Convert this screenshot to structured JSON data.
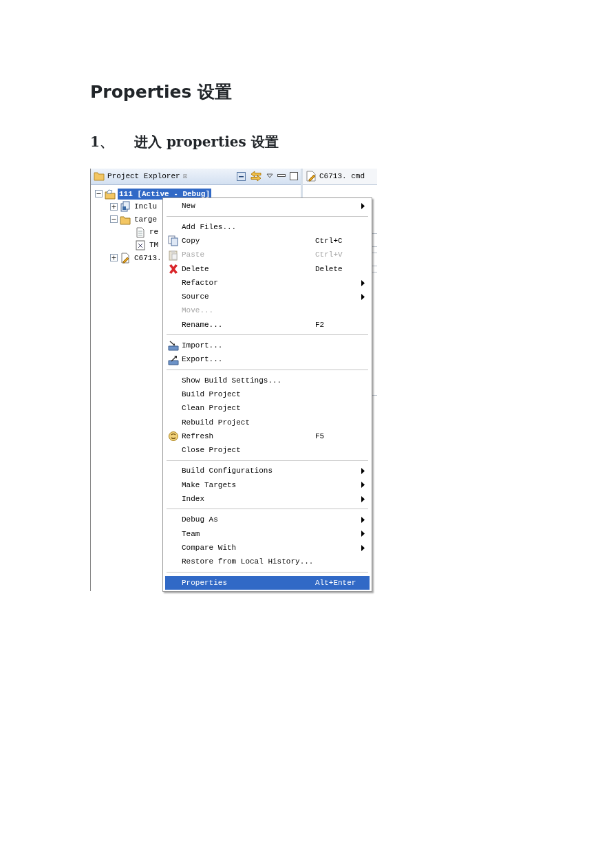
{
  "heading": "Properties 设置",
  "step": {
    "number": "1、",
    "text": "进入 properties 设置"
  },
  "explorer": {
    "title": "Project Explorer",
    "close": "☒",
    "tree": [
      {
        "label": "111  [Active - Debug]",
        "selected": true,
        "expanded": true,
        "children": [
          {
            "label": "Inclu",
            "selected": false,
            "expanded": false
          },
          {
            "label": "targe",
            "selected": false,
            "expanded": true,
            "children": [
              {
                "label": "re",
                "selected": false
              },
              {
                "label": "TM",
                "selected": false
              }
            ]
          },
          {
            "label": "C6713.",
            "selected": false,
            "expanded": false
          }
        ]
      }
    ]
  },
  "editor_tab": {
    "label": "C6713. cmd"
  },
  "menu": [
    {
      "kind": "item",
      "label": "New",
      "submenu": true,
      "disabled": false,
      "selected": false
    },
    {
      "kind": "separator"
    },
    {
      "kind": "item",
      "label": "Add Files...",
      "submenu": false,
      "disabled": false,
      "selected": false
    },
    {
      "kind": "item",
      "label": "Copy",
      "shortcut": "Ctrl+C",
      "submenu": false,
      "disabled": false,
      "selected": false
    },
    {
      "kind": "item",
      "label": "Paste",
      "shortcut": "Ctrl+V",
      "submenu": false,
      "disabled": true,
      "selected": false
    },
    {
      "kind": "item",
      "label": "Delete",
      "shortcut": "Delete",
      "submenu": false,
      "disabled": false,
      "selected": false
    },
    {
      "kind": "item",
      "label": "Refactor",
      "submenu": true,
      "disabled": false,
      "selected": false
    },
    {
      "kind": "item",
      "label": "Source",
      "submenu": true,
      "disabled": false,
      "selected": false
    },
    {
      "kind": "item",
      "label": "Move...",
      "submenu": false,
      "disabled": true,
      "selected": false
    },
    {
      "kind": "item",
      "label": "Rename...",
      "shortcut": "F2",
      "submenu": false,
      "disabled": false,
      "selected": false
    },
    {
      "kind": "separator"
    },
    {
      "kind": "item",
      "label": "Import...",
      "submenu": false,
      "disabled": false,
      "selected": false
    },
    {
      "kind": "item",
      "label": "Export...",
      "submenu": false,
      "disabled": false,
      "selected": false
    },
    {
      "kind": "separator"
    },
    {
      "kind": "item",
      "label": "Show Build Settings...",
      "submenu": false,
      "disabled": false,
      "selected": false
    },
    {
      "kind": "item",
      "label": "Build Project",
      "submenu": false,
      "disabled": false,
      "selected": false
    },
    {
      "kind": "item",
      "label": "Clean Project",
      "submenu": false,
      "disabled": false,
      "selected": false
    },
    {
      "kind": "item",
      "label": "Rebuild Project",
      "submenu": false,
      "disabled": false,
      "selected": false
    },
    {
      "kind": "item",
      "label": "Refresh",
      "shortcut": "F5",
      "submenu": false,
      "disabled": false,
      "selected": false
    },
    {
      "kind": "item",
      "label": "Close Project",
      "submenu": false,
      "disabled": false,
      "selected": false
    },
    {
      "kind": "separator"
    },
    {
      "kind": "item",
      "label": "Build Configurations",
      "submenu": true,
      "disabled": false,
      "selected": false
    },
    {
      "kind": "item",
      "label": "Make Targets",
      "submenu": true,
      "disabled": false,
      "selected": false
    },
    {
      "kind": "item",
      "label": "Index",
      "submenu": true,
      "disabled": false,
      "selected": false
    },
    {
      "kind": "separator"
    },
    {
      "kind": "item",
      "label": "Debug As",
      "submenu": true,
      "disabled": false,
      "selected": false
    },
    {
      "kind": "item",
      "label": "Team",
      "submenu": true,
      "disabled": false,
      "selected": false
    },
    {
      "kind": "item",
      "label": "Compare With",
      "submenu": true,
      "disabled": false,
      "selected": false
    },
    {
      "kind": "item",
      "label": "Restore from Local History...",
      "submenu": false,
      "disabled": false,
      "selected": false
    },
    {
      "kind": "separator"
    },
    {
      "kind": "item",
      "label": "Properties",
      "shortcut": "Alt+Enter",
      "submenu": false,
      "disabled": false,
      "selected": true
    }
  ]
}
